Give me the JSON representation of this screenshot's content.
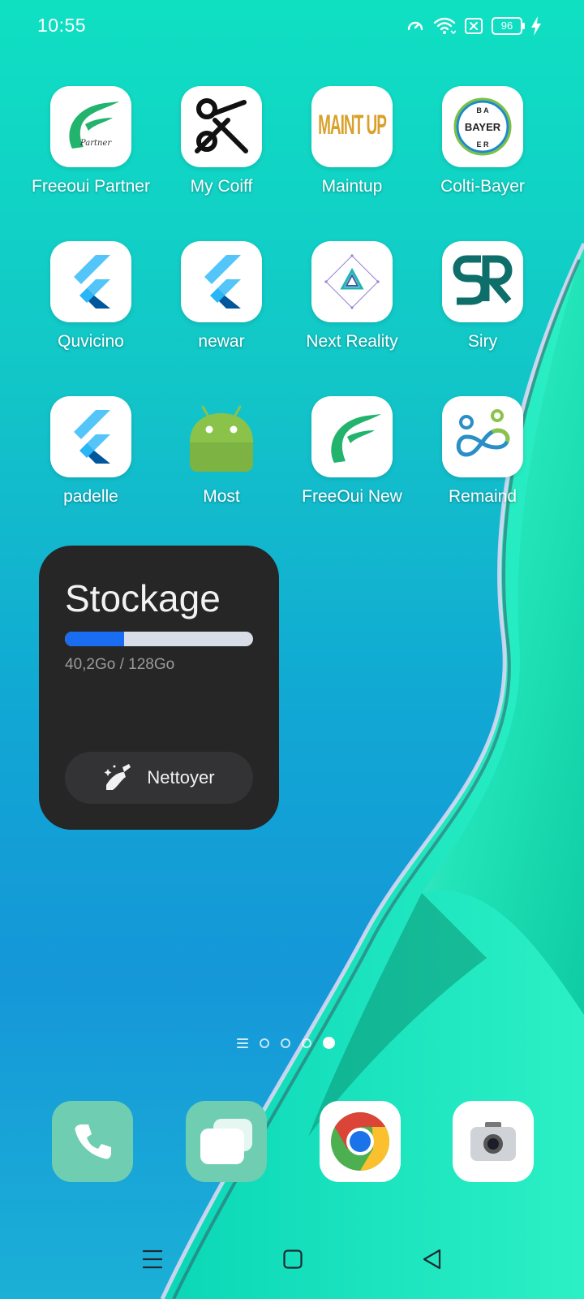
{
  "status_bar": {
    "time": "10:55",
    "battery_level": "96",
    "icons": [
      "data-saver-icon",
      "wifi-icon",
      "sim-disabled-icon",
      "battery-icon",
      "charging-bolt-icon"
    ]
  },
  "apps": [
    {
      "label": "Freeoui Partner",
      "icon": "freeoui-partner-logo",
      "icon_text": "Partner"
    },
    {
      "label": "My Coiff",
      "icon": "scissors-logo"
    },
    {
      "label": "Maintup",
      "icon": "maintup-logo",
      "icon_text": "MAINT UP"
    },
    {
      "label": "Colti-Bayer",
      "icon": "bayer-cross-logo",
      "icon_text": "BAYER"
    },
    {
      "label": "Quvicino",
      "icon": "flutter-logo"
    },
    {
      "label": "newar",
      "icon": "flutter-logo"
    },
    {
      "label": "Next Reality",
      "icon": "next-reality-logo"
    },
    {
      "label": "Siry",
      "icon": "sr-monogram-logo"
    },
    {
      "label": "padelle",
      "icon": "flutter-logo"
    },
    {
      "label": "Most",
      "icon": "android-logo"
    },
    {
      "label": "FreeOui New",
      "icon": "freeoui-logo"
    },
    {
      "label": "Remaind",
      "icon": "remaind-logo"
    }
  ],
  "storage_widget": {
    "title": "Stockage",
    "used": "40,2Go",
    "total": "128Go",
    "usage_text": "40,2Go / 128Go",
    "used_fraction": 0.314,
    "button_label": "Nettoyer",
    "button_icon": "broom-sparkle-icon"
  },
  "page_indicator": {
    "pages": 4,
    "current": 4
  },
  "dock": [
    {
      "name": "phone",
      "icon": "phone-icon",
      "color": "#6fcdb1"
    },
    {
      "name": "messages",
      "icon": "messages-icon",
      "color": "#6fcdb1"
    },
    {
      "name": "chrome",
      "icon": "chrome-icon",
      "color": "#ffffff"
    },
    {
      "name": "camera",
      "icon": "camera-icon",
      "color": "#ffffff"
    }
  ],
  "nav_bar": [
    "menu-icon",
    "home-icon",
    "back-icon"
  ],
  "colors": {
    "accent_bar": "#1a6cf0",
    "widget_bg": "#262626"
  }
}
